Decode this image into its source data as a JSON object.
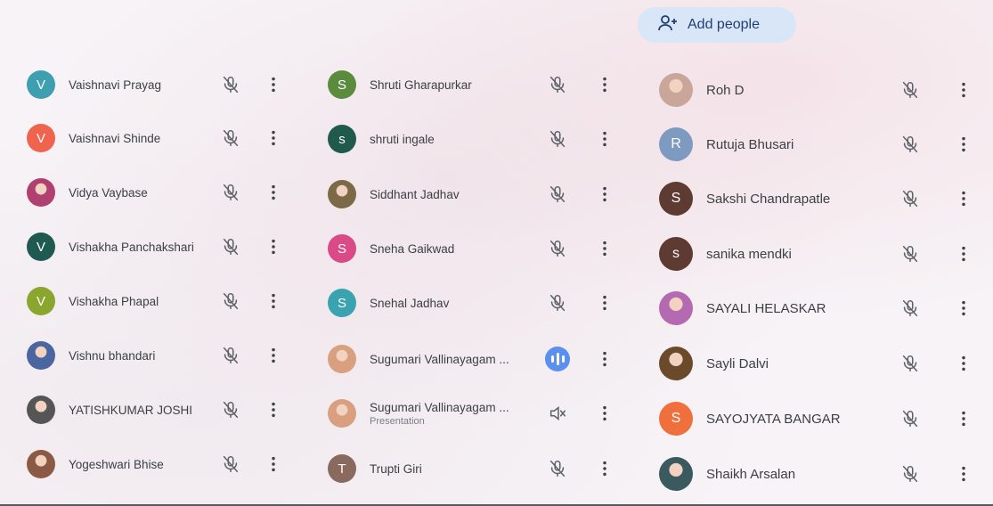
{
  "add_people": {
    "label": "Add people"
  },
  "columns": [
    [
      {
        "name": "Vaishnavi Prayag",
        "initial": "V",
        "color": "#3d9fb0"
      },
      {
        "name": "Vaishnavi Shinde",
        "initial": "V",
        "color": "#f0634d"
      },
      {
        "name": "Vidya Vaybase",
        "initial": "",
        "color": "#b04070",
        "photo": true
      },
      {
        "name": "Vishakha Panchakshari",
        "initial": "V",
        "color": "#1e5a52"
      },
      {
        "name": "Vishakha Phapal",
        "initial": "V",
        "color": "#8aa62e"
      },
      {
        "name": "Vishnu bhandari",
        "initial": "",
        "color": "#4a66a0",
        "photo": true
      },
      {
        "name": "YATISHKUMAR JOSHI",
        "initial": "",
        "color": "#555555",
        "photo": true
      },
      {
        "name": "Yogeshwari Bhise",
        "initial": "",
        "color": "#8a5a45",
        "photo": true
      }
    ],
    [
      {
        "name": "Shruti Gharapurkar",
        "initial": "S",
        "color": "#5b8b3d"
      },
      {
        "name": "shruti ingale",
        "initial": "s",
        "color": "#1f5a4d"
      },
      {
        "name": "Siddhant Jadhav",
        "initial": "",
        "color": "#7b6a45",
        "photo": true
      },
      {
        "name": "Sneha Gaikwad",
        "initial": "S",
        "color": "#d94a86"
      },
      {
        "name": "Snehal Jadhav",
        "initial": "S",
        "color": "#3aa3b0"
      },
      {
        "name": "Sugumari Vallinayagam ...",
        "initial": "",
        "color": "#d9a080",
        "photo": true,
        "speaking": true
      },
      {
        "name": "Sugumari Vallinayagam ...",
        "sub": "Presentation",
        "initial": "",
        "color": "#d9a080",
        "photo": true,
        "presenting": true
      },
      {
        "name": "Trupti Giri",
        "initial": "T",
        "color": "#8a6a5e"
      }
    ],
    [
      {
        "name": "Roh D",
        "initial": "",
        "color": "#c9a59a",
        "photo": true
      },
      {
        "name": "Rutuja Bhusari",
        "initial": "R",
        "color": "#7f9ac0"
      },
      {
        "name": "Sakshi Chandrapatle",
        "initial": "S",
        "color": "#5d3a32"
      },
      {
        "name": "sanika mendki",
        "initial": "s",
        "color": "#5d3a32"
      },
      {
        "name": "SAYALI HELASKAR",
        "initial": "",
        "color": "#b46ab0",
        "photo": true
      },
      {
        "name": "Sayli Dalvi",
        "initial": "",
        "color": "#6a4a2a",
        "photo": true
      },
      {
        "name": "SAYOJYATA BANGAR",
        "initial": "S",
        "color": "#f0703d"
      },
      {
        "name": "Shaikh Arsalan",
        "initial": "",
        "color": "#3a5a60",
        "photo": true
      }
    ]
  ]
}
